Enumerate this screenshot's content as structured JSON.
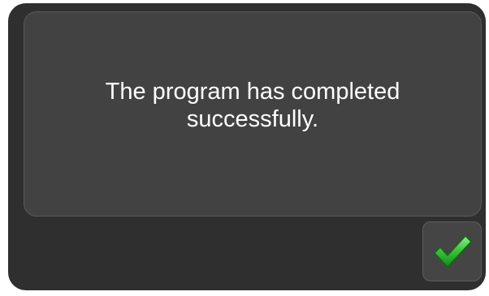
{
  "dialog": {
    "message": "The program has completed successfully.",
    "ok_button": {
      "icon": "checkmark-icon",
      "icon_color": "#3fc63f"
    }
  }
}
